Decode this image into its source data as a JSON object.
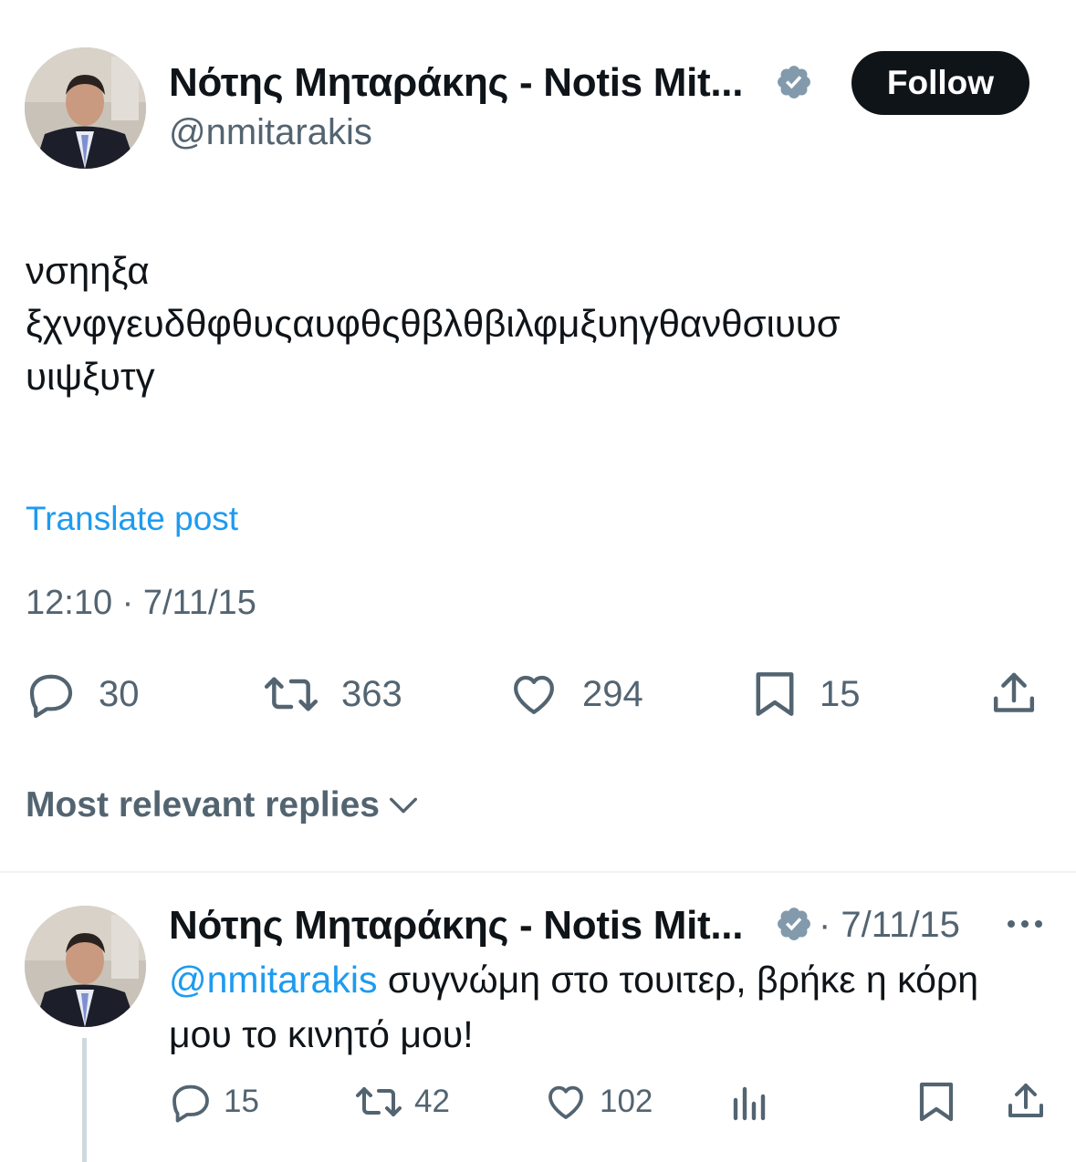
{
  "colors": {
    "accent": "#1d9bf0",
    "text": "#0f1419",
    "secondary": "#536471",
    "verified": "#829aab"
  },
  "post": {
    "author_name": "Νότης Μηταράκης - Notis Mit...",
    "handle": "@nmitarakis",
    "follow_label": "Follow",
    "text": "νσηηξα\nξχνφγευδθφθυςαυφθςθβλθβιλφμξυηγθανθσιυυσ\nυιψξυτγ",
    "translate_label": "Translate post",
    "timestamp": "12:10 · 7/11/15",
    "actions": {
      "replies": "30",
      "reposts": "363",
      "likes": "294",
      "bookmarks": "15"
    }
  },
  "sort": {
    "label": "Most relevant replies"
  },
  "reply": {
    "author_name": "Νότης Μηταράκης - Notis Mit...",
    "date": "· 7/11/15",
    "mention": "@nmitarakis",
    "text": " συγνώμη στο τουιτερ, βρήκε η κόρη μου το κινητό μου!",
    "actions": {
      "replies": "15",
      "reposts": "42",
      "likes": "102"
    }
  },
  "icons": [
    "verified-badge-icon",
    "reply-icon",
    "repost-icon",
    "like-icon",
    "bookmark-icon",
    "share-icon",
    "views-icon",
    "more-icon",
    "chevron-down-icon"
  ]
}
